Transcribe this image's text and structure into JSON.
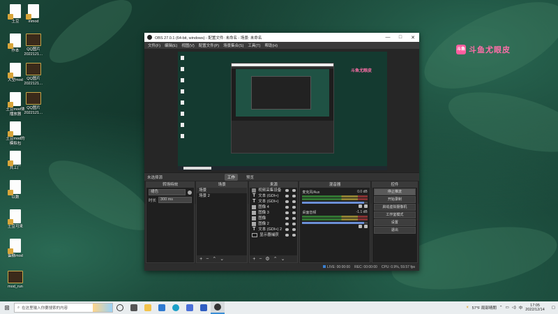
{
  "desktop": {
    "icons": [
      {
        "label": "土豆",
        "kind": "doc"
      },
      {
        "label": "inmod",
        "kind": "doc"
      },
      {
        "label": "作本",
        "kind": "doc"
      },
      {
        "label": "QQ图片\n2022121…",
        "kind": "img"
      },
      {
        "label": "大型mod",
        "kind": "doc"
      },
      {
        "label": "QQ图片\n2022121…",
        "kind": "img"
      },
      {
        "label": "土豆mod体\n播放器",
        "kind": "doc"
      },
      {
        "label": "QQ图片\n2022121…",
        "kind": "img"
      },
      {
        "label": "土豆mod的\n模拟包",
        "kind": "doc"
      },
      {
        "label": "共工厂",
        "kind": "doc"
      },
      {
        "label": "以数",
        "kind": "doc"
      },
      {
        "label": "土豆可来",
        "kind": "doc"
      },
      {
        "label": "蛋糕mod",
        "kind": "doc"
      },
      {
        "label": "mod_run",
        "kind": "img"
      }
    ]
  },
  "watermark": {
    "text": "斗鱼尤眼皮",
    "logo": "斗鱼"
  },
  "obs": {
    "title": "OBS 27.0.1 (64-bit, windows) - 配置文件: 未命名 - 场景: 未命名",
    "window_buttons": {
      "minimize": "—",
      "maximize": "□",
      "close": "✕"
    },
    "menu": [
      "文件(F)",
      "编辑(E)",
      "视图(V)",
      "配置文件(P)",
      "场景集合(S)",
      "工具(T)",
      "帮助(H)"
    ],
    "modebar": {
      "left_label": "未选择源",
      "studio": "工作",
      "preview": "预览"
    },
    "docks": {
      "transitions": {
        "header": "转场特效",
        "type": "褪色",
        "duration_label": "时长",
        "duration_value": "300 ms"
      },
      "scenes": {
        "header": "场景",
        "items": [
          "场景",
          "场景 2"
        ]
      },
      "sources": {
        "header": "来源",
        "items": [
          {
            "name": "视频采集设备",
            "icon": "camera-icon"
          },
          {
            "name": "文本 (GDI+)",
            "icon": "text-icon"
          },
          {
            "name": "文本 (GDI+)",
            "icon": "text-icon"
          },
          {
            "name": "图像 4",
            "icon": "image-icon"
          },
          {
            "name": "图像 3",
            "icon": "image-icon"
          },
          {
            "name": "图像",
            "icon": "image-icon"
          },
          {
            "name": "图像 2",
            "icon": "image-icon"
          },
          {
            "name": "文本 (GDI+) 2",
            "icon": "text-icon"
          },
          {
            "name": "显示器捕获",
            "icon": "display-icon"
          }
        ]
      },
      "mixer": {
        "header": "混音器",
        "channels": [
          {
            "name": "麦克风/Aux",
            "level": "0.0 dB"
          },
          {
            "name": "桌面音频",
            "level": "-1.1 dB"
          }
        ]
      },
      "controls": {
        "header": "控件",
        "buttons": [
          "停止推流",
          "开始录制",
          "启动虚拟摄像机",
          "工作室模式",
          "设置",
          "退出"
        ]
      }
    },
    "status": {
      "live": "LIVE: 00:00:00",
      "rec": "REC: 00:00:00",
      "cpu": "CPU: 0.9%, 59.57 fps"
    }
  },
  "taskbar": {
    "search_placeholder": "在这里输入你要搜索的内容",
    "weather": "57°F 局部晴朗",
    "lang": "中",
    "time": "17:05",
    "date": "2022/12/14"
  },
  "colors": {
    "accent": "#3b8ed6",
    "watermark": "#ff6ea8",
    "obs_bg": "#2b2b2b"
  }
}
